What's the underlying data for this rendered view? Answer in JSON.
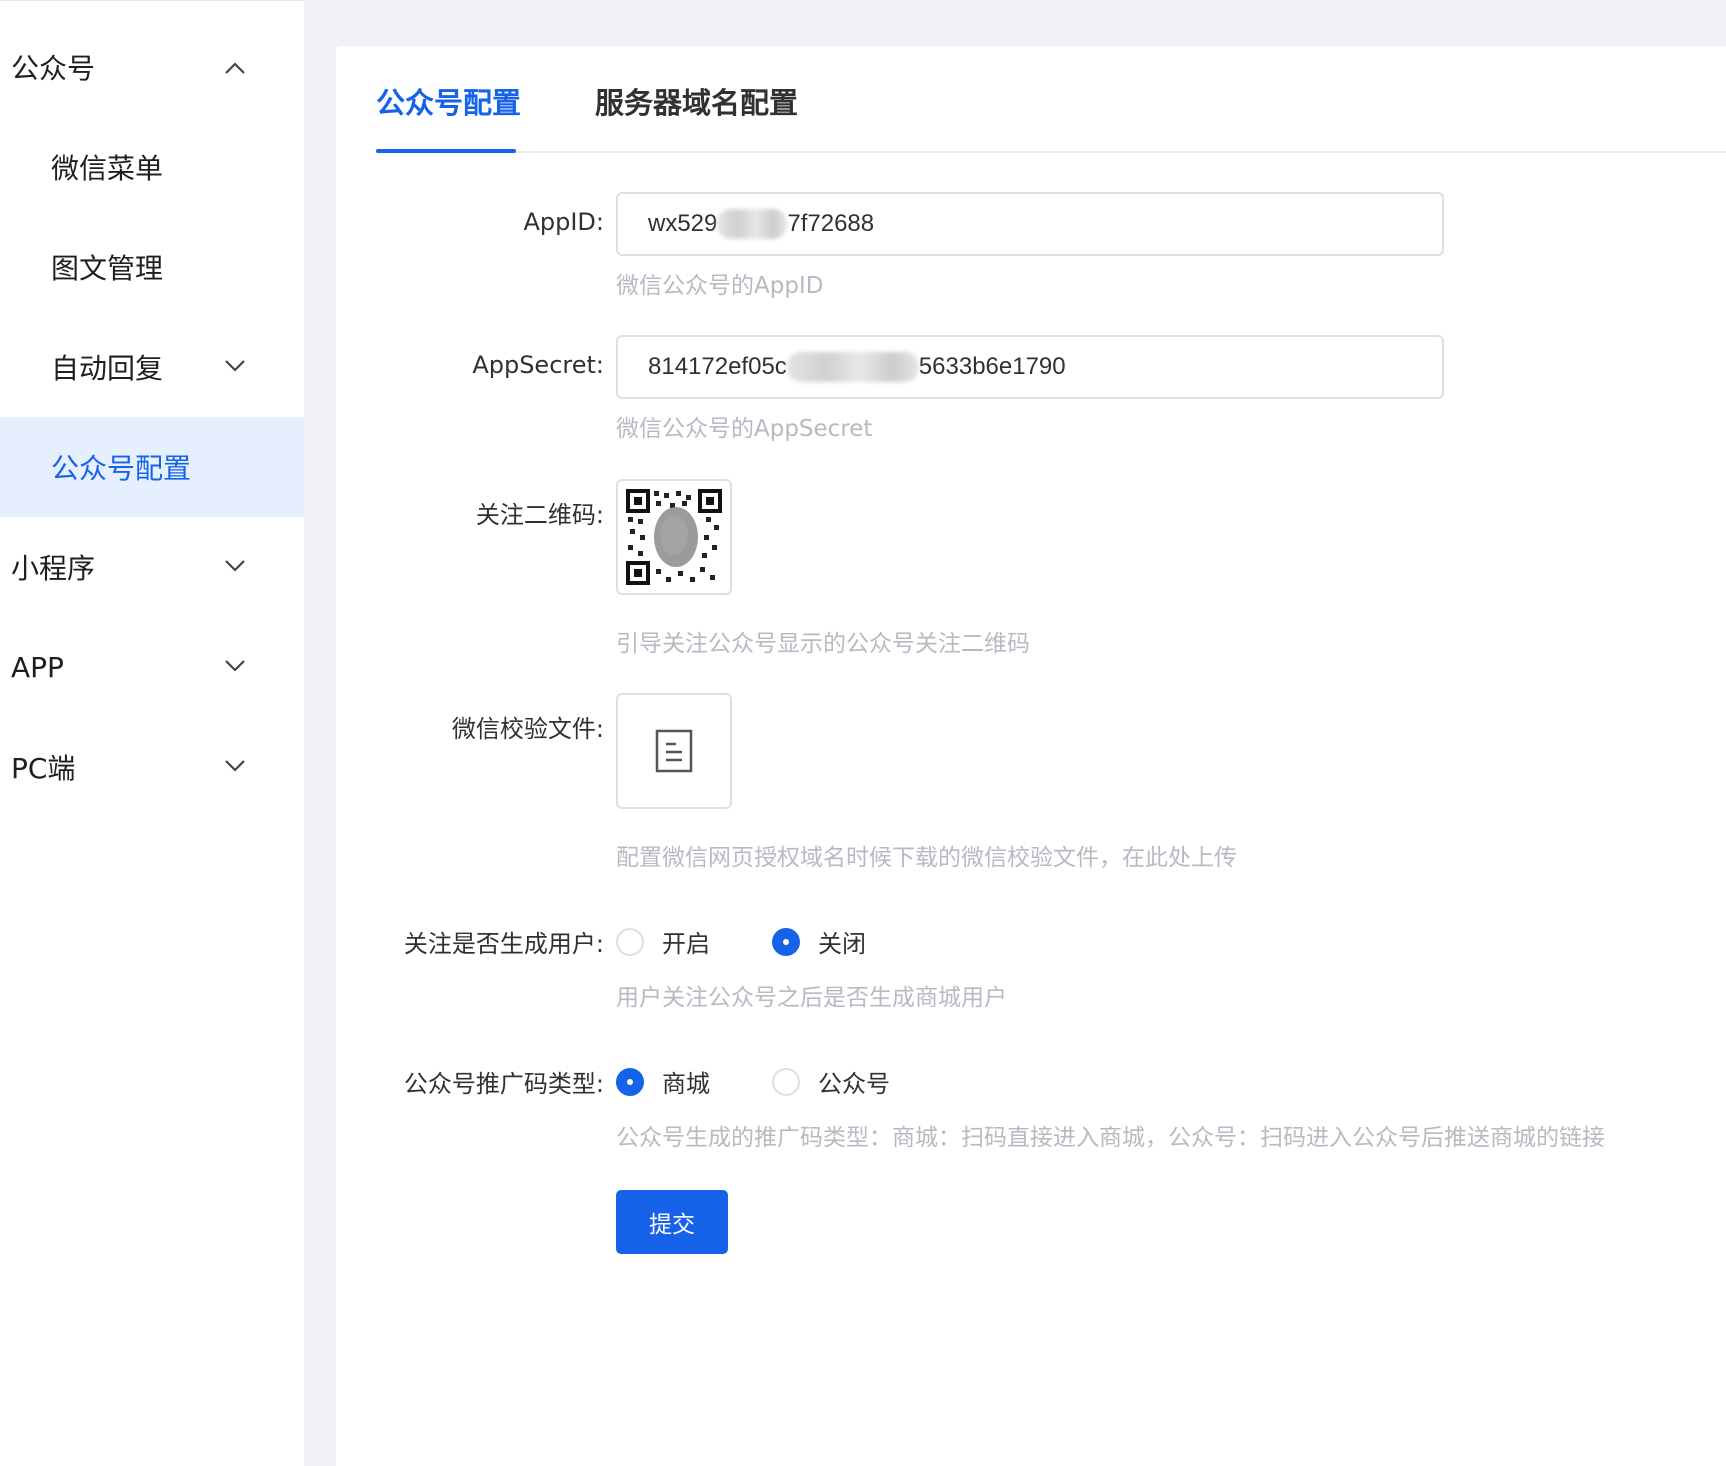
{
  "sidebar": {
    "groups": [
      {
        "label": "公众号",
        "expanded": true
      },
      {
        "label": "小程序",
        "expanded": false
      },
      {
        "label": "APP",
        "expanded": false
      },
      {
        "label": "PC端",
        "expanded": false
      }
    ],
    "sub_items": [
      {
        "label": "微信菜单"
      },
      {
        "label": "图文管理"
      },
      {
        "label": "自动回复"
      },
      {
        "label": "公众号配置",
        "active": true
      }
    ]
  },
  "tabs": [
    {
      "label": "公众号配置",
      "active": true
    },
    {
      "label": "服务器域名配置",
      "active": false
    }
  ],
  "form": {
    "appid": {
      "label": "AppID:",
      "value_prefix": "wx529",
      "value_suffix": "7f72688",
      "help": "微信公众号的AppID"
    },
    "appsecret": {
      "label": "AppSecret:",
      "value_prefix": "814172ef05c",
      "value_suffix": "5633b6e1790",
      "help": "微信公众号的AppSecret"
    },
    "qrcode": {
      "label": "关注二维码:",
      "help": "引导关注公众号显示的公众号关注二维码"
    },
    "verify_file": {
      "label": "微信校验文件:",
      "help": "配置微信网页授权域名时候下载的微信校验文件，在此处上传"
    },
    "follow_user": {
      "label": "关注是否生成用户:",
      "options": [
        "开启",
        "关闭"
      ],
      "selected": "关闭",
      "help": "用户关注公众号之后是否生成商城用户"
    },
    "promo_type": {
      "label": "公众号推广码类型:",
      "options": [
        "商城",
        "公众号"
      ],
      "selected": "商城",
      "help": "公众号生成的推广码类型：商城：扫码直接进入商城，公众号：扫码进入公众号后推送商城的链接"
    },
    "submit_label": "提交"
  },
  "colors": {
    "primary": "#1663ea",
    "active_bg": "#e6effd",
    "help_text": "#b6bac2",
    "page_bg": "#f0f2f5"
  },
  "icons": {
    "expand": "chevron-down-icon",
    "collapse": "chevron-up-icon",
    "file": "document-icon"
  }
}
